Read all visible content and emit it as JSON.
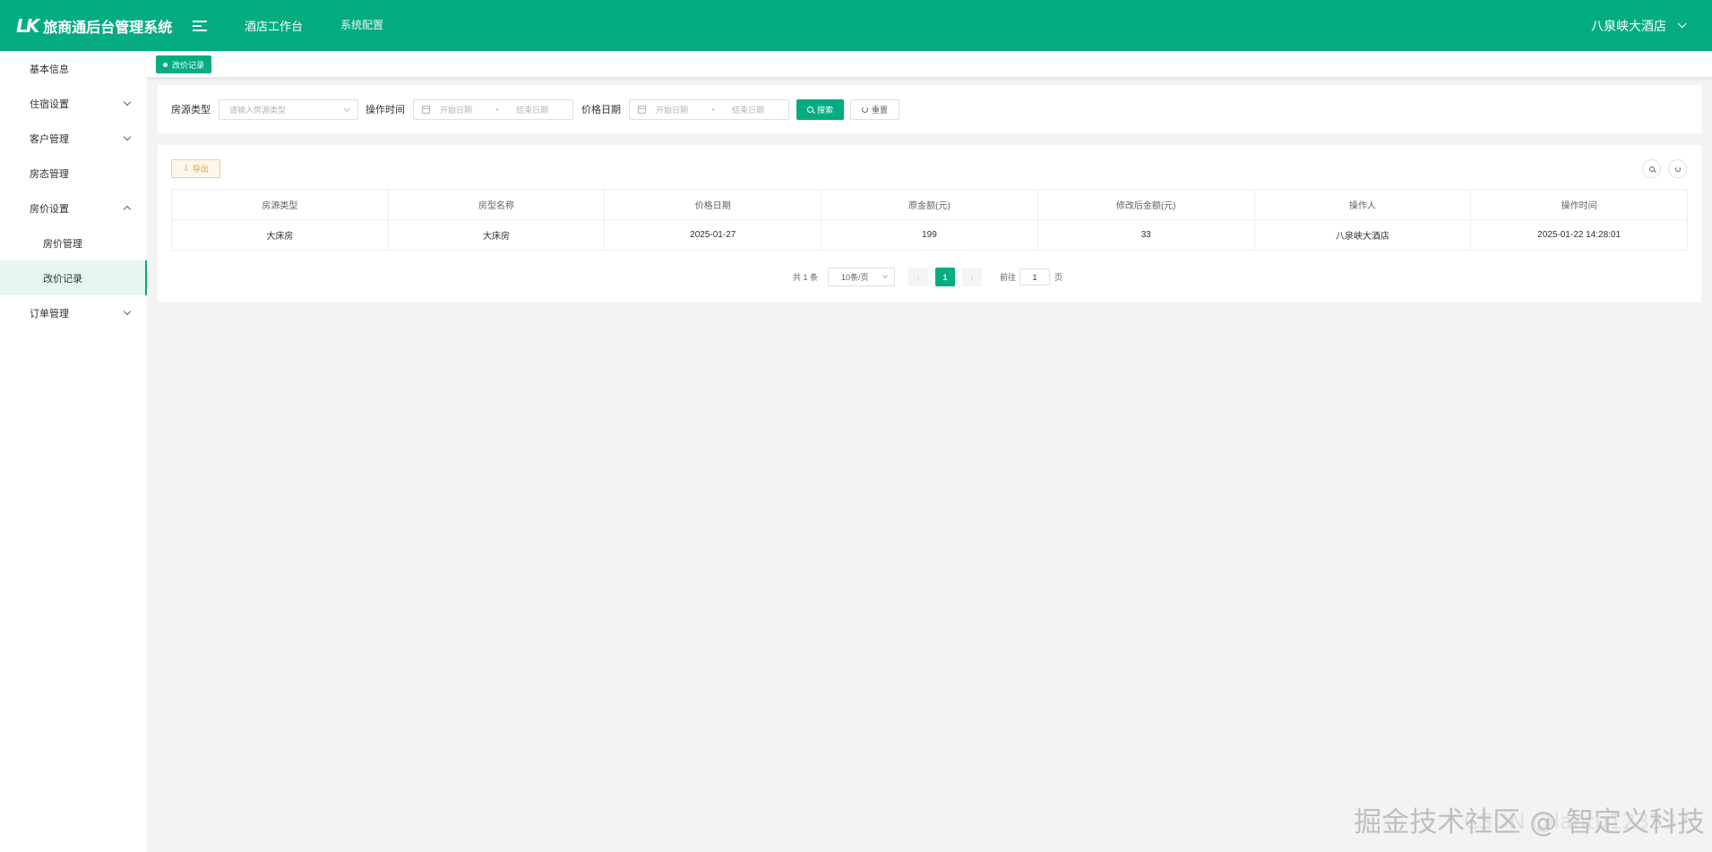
{
  "header": {
    "logo_mark": "LK",
    "app_title": "旅商通后台管理系统",
    "nav": [
      "酒店工作台",
      "系统配置"
    ],
    "user_name": "八泉峡大酒店"
  },
  "sidebar": {
    "items": [
      {
        "label": "基本信息"
      },
      {
        "label": "住宿设置"
      },
      {
        "label": "客户管理"
      },
      {
        "label": "房态管理"
      },
      {
        "label": "房价设置"
      },
      {
        "label": "房价管理"
      },
      {
        "label": "改价记录"
      },
      {
        "label": "订单管理"
      }
    ]
  },
  "tags": [
    {
      "label": "改价记录"
    }
  ],
  "search": {
    "room_type_label": "房源类型",
    "room_type_placeholder": "请输入房源类型",
    "op_time_label": "操作时间",
    "price_date_label": "价格日期",
    "start_placeholder": "开始日期",
    "range_sep": "-",
    "end_placeholder": "结束日期",
    "search_btn": "搜索",
    "reset_btn": "重置"
  },
  "toolbar": {
    "export_btn": "导出"
  },
  "table": {
    "columns": [
      "房源类型",
      "房型名称",
      "价格日期",
      "原金额(元)",
      "修改后金额(元)",
      "操作人",
      "操作时间"
    ],
    "rows": [
      [
        "大床房",
        "大床房",
        "2025-01-27",
        "199",
        "33",
        "八泉峡大酒店",
        "2025-01-22 14:28:01"
      ]
    ]
  },
  "pagination": {
    "total_text": "共 1 条",
    "page_size": "10条/页",
    "current_page": "1",
    "goto_label": "前往",
    "jump_value": "1",
    "page_unit": "页"
  },
  "watermark": {
    "text": "掘金技术社区 @ 智定义科技",
    "text2": "CSDN @lantu123337"
  },
  "colors": {
    "primary": "#05ac82",
    "warning": "#e6a23c"
  }
}
